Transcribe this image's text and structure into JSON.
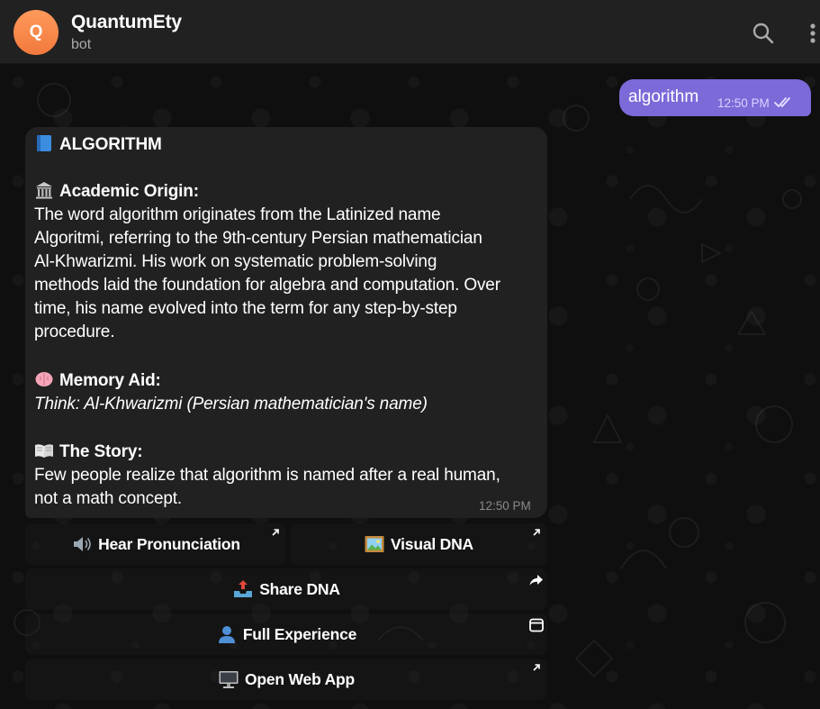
{
  "header": {
    "avatar_letter": "Q",
    "title": "QuantumEty",
    "subtitle": "bot",
    "icons": [
      "search-icon",
      "more-vertical-icon"
    ]
  },
  "outgoing": {
    "text": "algorithm",
    "time": "12:50 PM",
    "status_icon": "double-check-icon"
  },
  "incoming": {
    "title": "ALGORITHM",
    "title_icon": "blue-book-emoji",
    "origin_heading": "Academic Origin:",
    "origin_icon": "classical-building-emoji",
    "origin_lines": [
      "The word algorithm originates from the Latinized name",
      "Algoritmi, referring to the 9th-century Persian mathematician",
      "Al-Khwarizmi. His work on systematic problem-solving",
      "methods laid the foundation for algebra and computation. Over",
      "time, his name evolved into the term for any step-by-step",
      "procedure."
    ],
    "memory_heading": "Memory Aid:",
    "memory_icon": "brain-emoji",
    "memory_text": "Think: Al-Khwarizmi (Persian mathematician's name)",
    "story_heading": "The Story:",
    "story_icon": "open-book-emoji",
    "story_lines": [
      "Few people realize that algorithm is named after a real human,",
      "not a math concept."
    ],
    "time": "12:50 PM"
  },
  "keyboard": {
    "hear": {
      "label": "Hear Pronunciation",
      "icon": "speaker-emoji",
      "corner": "arrow-up-right-icon"
    },
    "visual": {
      "label": "Visual DNA",
      "icon": "framed-picture-emoji",
      "corner": "arrow-up-right-icon"
    },
    "share": {
      "label": "Share DNA",
      "icon": "outbox-tray-emoji",
      "corner": "share-arrow-icon"
    },
    "full": {
      "label": "Full Experience",
      "icon": "bust-silhouette-emoji",
      "corner": "window-icon"
    },
    "webapp": {
      "label": "Open Web App",
      "icon": "desktop-computer-emoji",
      "corner": "arrow-up-right-icon"
    }
  },
  "colors": {
    "header_bg": "#212121",
    "avatar": "#f2793d",
    "outgoing_bubble": "#7b6ad8",
    "incoming_bubble": "#212121",
    "background": "#0f0f0f"
  }
}
